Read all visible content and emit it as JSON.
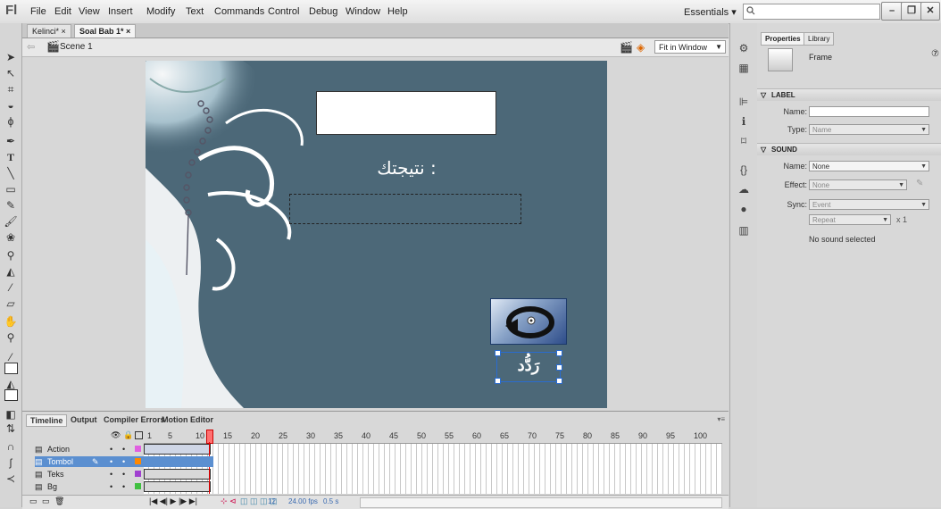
{
  "app": {
    "logo": "Fl"
  },
  "menu": [
    "File",
    "Edit",
    "View",
    "Insert",
    "Modify",
    "Text",
    "Commands",
    "Control",
    "Debug",
    "Window",
    "Help"
  ],
  "workspace": {
    "label": "Essentials ▾"
  },
  "window_buttons": {
    "minimize": "–",
    "restore": "❐",
    "close": "✕"
  },
  "doc_tabs": [
    {
      "label": "Kelinci* ×"
    },
    {
      "label": "Soal Bab 1* ×"
    }
  ],
  "scene": {
    "label": "Scene 1",
    "zoom": "Fit in Window"
  },
  "stage": {
    "result_label": "نتيجتك :",
    "button_text": "رَدُّد",
    "bg_color": "#4c6878"
  },
  "timeline": {
    "tabs": [
      "Timeline",
      "Output",
      "Compiler Errors",
      "Motion Editor"
    ],
    "frame_numbers": [
      "1",
      "5",
      "10",
      "15",
      "20",
      "25",
      "30",
      "35",
      "40",
      "45",
      "50",
      "55",
      "60",
      "65",
      "70",
      "75",
      "80",
      "85",
      "90",
      "95",
      "100"
    ],
    "layers": [
      {
        "name": "Action",
        "color": "#e060e0",
        "selected": false
      },
      {
        "name": "Tombol",
        "color": "#ff8800",
        "selected": true
      },
      {
        "name": "Teks",
        "color": "#a040d0",
        "selected": false
      },
      {
        "name": "Bg",
        "color": "#40c040",
        "selected": false
      }
    ],
    "status": {
      "frame": "12",
      "fps": "24.00 fps",
      "time": "0.5 s"
    }
  },
  "properties": {
    "tabs": [
      "Properties",
      "Library"
    ],
    "object_type": "Frame",
    "label_section": "LABEL",
    "name_label": "Name:",
    "type_label": "Type:",
    "type_value": "Name",
    "sound_section": "SOUND",
    "sound_name_label": "Name:",
    "sound_name_value": "None",
    "effect_label": "Effect:",
    "effect_value": "None",
    "sync_label": "Sync:",
    "sync_value": "Event",
    "repeat_value": "Repeat",
    "repeat_count": "x  1",
    "no_sound": "No sound selected"
  }
}
